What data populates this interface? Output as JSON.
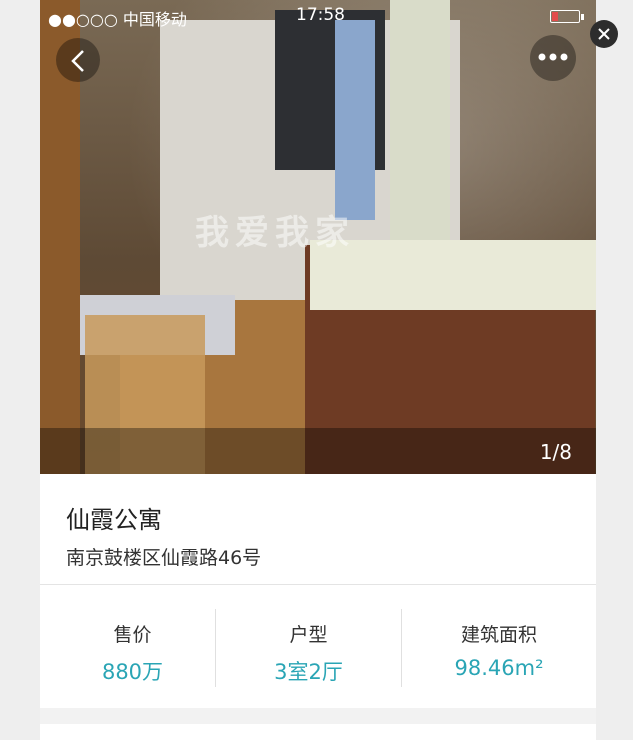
{
  "status_bar": {
    "carrier": "●●○○○ 中国移动",
    "time": "17:58"
  },
  "photo": {
    "counter": "1/8",
    "watermark": "我爱我家"
  },
  "listing": {
    "title": "仙霞公寓",
    "address": "南京鼓楼区仙霞路46号"
  },
  "stats": [
    {
      "label": "售价",
      "value": "880万"
    },
    {
      "label": "户型",
      "value": "3室2厅"
    },
    {
      "label": "建筑面积",
      "value": "98.46m²"
    }
  ],
  "colors": {
    "accent": "#2aa5b5"
  },
  "icons": {
    "back": "chevron-left-icon",
    "more": "more-dots-icon",
    "close": "close-icon"
  }
}
